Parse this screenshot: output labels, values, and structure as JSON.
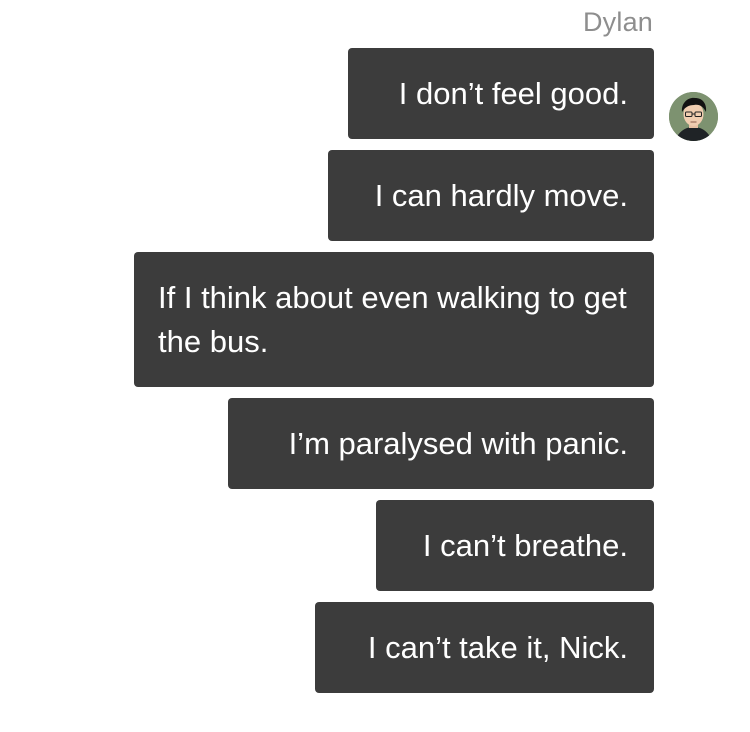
{
  "conversation": {
    "sender_name": "Dylan",
    "avatar_icon": "dylan-avatar",
    "bubble_color": "#3c3c3c",
    "messages": [
      {
        "text": "I don’t feel good."
      },
      {
        "text": "I can hardly move."
      },
      {
        "text": "If I think about even walking to get the bus."
      },
      {
        "text": "I’m paralysed with panic."
      },
      {
        "text": "I can’t breathe."
      },
      {
        "text": "I can’t take it, Nick."
      }
    ]
  }
}
